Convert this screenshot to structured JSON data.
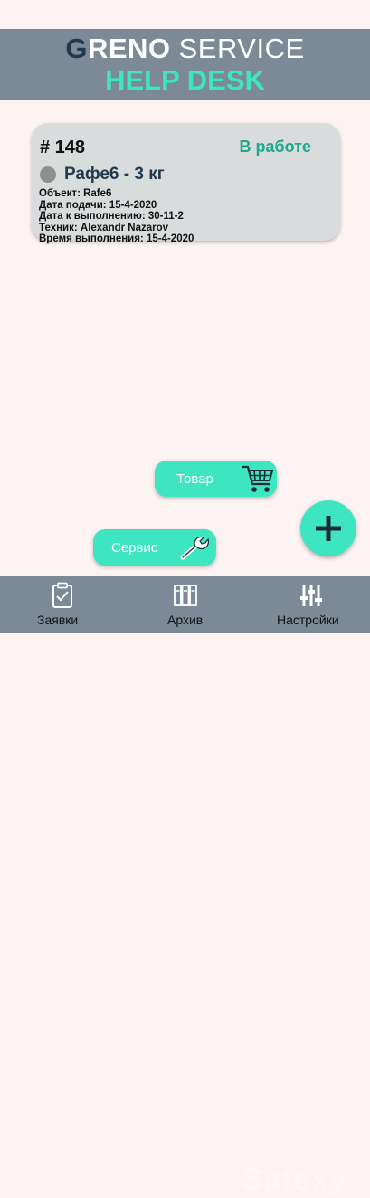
{
  "header": {
    "brand_g": "G",
    "brand_reno": "RENO",
    "brand_service": " SERVICE",
    "subtitle": "HELP DESK"
  },
  "ticket": {
    "number": "# 148",
    "status": "В работе",
    "status_color": "#1fa88a",
    "title": "Рафе6 - 3 кг",
    "rows": [
      "Объект: Rafe6",
      "Дата подачи:  15-4-2020",
      "Дата к выполнению:  30-11-2",
      "Техник:  Alexandr Nazarov",
      "Время выполнения:  15-4-2020"
    ]
  },
  "actions": {
    "tovar_label": "Товар",
    "servis_label": "Сервис",
    "fab_icon": "plus-icon"
  },
  "nav": {
    "items": [
      {
        "label": "Заявки",
        "icon": "clipboard-icon"
      },
      {
        "label": "Архив",
        "icon": "binders-icon"
      },
      {
        "label": "Настройки",
        "icon": "sliders-icon"
      }
    ]
  },
  "watermark": "Satexy",
  "colors": {
    "accent": "#3de6c1",
    "bar": "#7b8a96",
    "background": "#fdf3f2"
  }
}
